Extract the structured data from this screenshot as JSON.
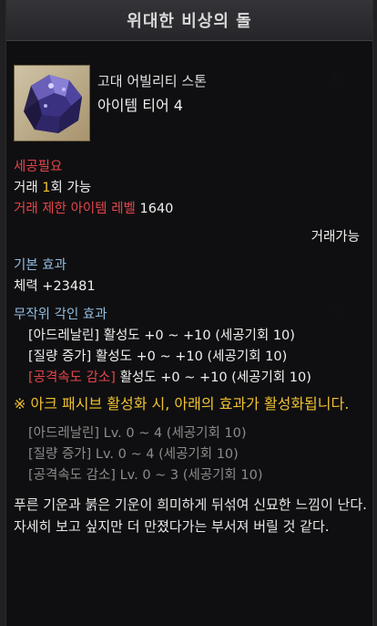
{
  "window": {
    "title": "위대한 비상의 돌"
  },
  "item": {
    "type": "고대 어빌리티 스톤",
    "tier": "아이템 티어 4"
  },
  "requirements": {
    "carve_required": "세공필요",
    "trade_prefix": "거래 ",
    "trade_count": "1",
    "trade_suffix": "회 가능",
    "trade_restrict_label": "거래 제한 아이템 레벨",
    "trade_restrict_level": "1640",
    "tradeable": "거래가능"
  },
  "basic_effect": {
    "header": "기본 효과",
    "value": "체력 +23481"
  },
  "random_engrave": {
    "header": "무작위 각인 효과",
    "items": [
      {
        "name": "[아드레날린]",
        "text": " 활성도 +0 ~ +10 (세공기회 10)",
        "color": "#f0f0f0"
      },
      {
        "name": "[질량 증가]",
        "text": " 활성도 +0 ~ +10 (세공기회 10)",
        "color": "#f0f0f0"
      },
      {
        "name": "[공격속도 감소]",
        "text": " 활성도 +0 ~ +10 (세공기회 10)",
        "color": "#e4454a"
      }
    ]
  },
  "ark_passive": {
    "notice": "※ 아크 패시브 활성화 시, 아래의 효과가 활성화됩니다.",
    "items": [
      "[아드레날린] Lv. 0 ~ 4 (세공기회 10)",
      "[질량 증가] Lv. 0 ~ 4 (세공기회 10)",
      "[공격속도 감소] Lv. 0 ~ 3 (세공기회 10)"
    ]
  },
  "description": "푸른 기운과 붉은 기운이 희미하게 뒤섞여 신묘한 느낌이 난다. 자세히 보고 싶지만 더 만졌다가는 부서져 버릴 것 같다.",
  "icons": {
    "item_image": "ability-stone-icon"
  }
}
